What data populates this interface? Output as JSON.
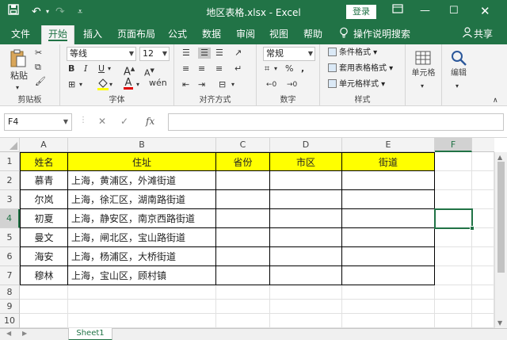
{
  "titlebar": {
    "title": "地区表格.xlsx  -  Excel",
    "login": "登录",
    "accent": "#217346"
  },
  "tabs": [
    "文件",
    "开始",
    "插入",
    "页面布局",
    "公式",
    "数据",
    "审阅",
    "视图",
    "帮助",
    "操作说明搜索"
  ],
  "share": "共享",
  "ribbon": {
    "clipboard": {
      "paste": "粘贴",
      "label": "剪贴板"
    },
    "font": {
      "name": "等线",
      "size": "12",
      "label": "字体"
    },
    "alignment": {
      "label": "对齐方式"
    },
    "number": {
      "format": "常规",
      "label": "数字"
    },
    "styles": {
      "conditional": "条件格式",
      "table": "套用表格格式",
      "cell": "单元格样式",
      "label": "样式"
    },
    "cells": {
      "label": "单元格"
    },
    "editing": {
      "label": "编辑"
    }
  },
  "formula_bar": {
    "name_box": "F4",
    "fx": "fx",
    "value": ""
  },
  "sheet": {
    "columns": [
      "A",
      "B",
      "C",
      "D",
      "E",
      "F"
    ],
    "rows": [
      "1",
      "2",
      "3",
      "4",
      "5",
      "6",
      "7",
      "8",
      "9",
      "10"
    ],
    "headers": [
      "姓名",
      "住址",
      "省份",
      "市区",
      "街道"
    ],
    "records": [
      [
        "慕青",
        "上海，黄浦区，外滩街道",
        "",
        "",
        ""
      ],
      [
        "尔岚",
        "上海，徐汇区，湖南路街道",
        "",
        "",
        ""
      ],
      [
        "初夏",
        "上海，静安区，南京西路街道",
        "",
        "",
        ""
      ],
      [
        "曼文",
        "上海，闸北区，宝山路街道",
        "",
        "",
        ""
      ],
      [
        "海安",
        "上海，杨浦区，大桥街道",
        "",
        "",
        ""
      ],
      [
        "穆林",
        "上海，宝山区，顾村镇",
        "",
        "",
        ""
      ]
    ],
    "header_fill": "#ffff00",
    "selected_cell": "F4"
  },
  "sheet_tabs": [
    "Sheet1"
  ]
}
